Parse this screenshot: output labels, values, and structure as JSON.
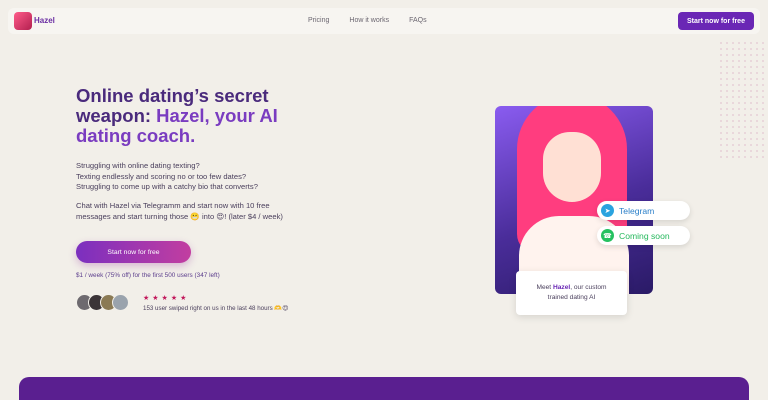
{
  "header": {
    "brand": "Hazel",
    "nav": [
      "Pricing",
      "How it works",
      "FAQs"
    ],
    "cta": "Start now for free"
  },
  "hero": {
    "title_line1": "Online dating’s secret",
    "title_line2a": "weapon: ",
    "title_line2b": "Hazel, your AI",
    "title_line3": "dating coach.",
    "q1": "Struggling with online dating texting?",
    "q2": "Texting endlessly and scoring no or too few dates?",
    "q3": "Struggling to come up with a catchy bio that converts?",
    "p2a": "Chat with Hazel via Telegramm and start now with 10 free",
    "p2b": "messages and start turning those 😬 into 😍!  (later $4 / week)",
    "cta": "Start now for free",
    "price_note": "$1 / week (75% off) for the first 500 users (347 left)",
    "stars": "★★★★★",
    "rating": 5,
    "social_proof": "153 user swiped right on us in the last 48 hours 🫶😍"
  },
  "card": {
    "telegram": "Telegram",
    "whatsapp": "Coming soon",
    "meet_pre": "Meet ",
    "meet_name": "Hazel",
    "meet_post": ", our custom",
    "meet_line2": "trained dating AI"
  },
  "colors": {
    "primary": "#6a27b5",
    "accent": "#c23ea0",
    "telegram": "#2aa3df",
    "whatsapp": "#25c160"
  },
  "icons": {
    "telegram": "telegram-icon",
    "whatsapp": "whatsapp-icon"
  }
}
